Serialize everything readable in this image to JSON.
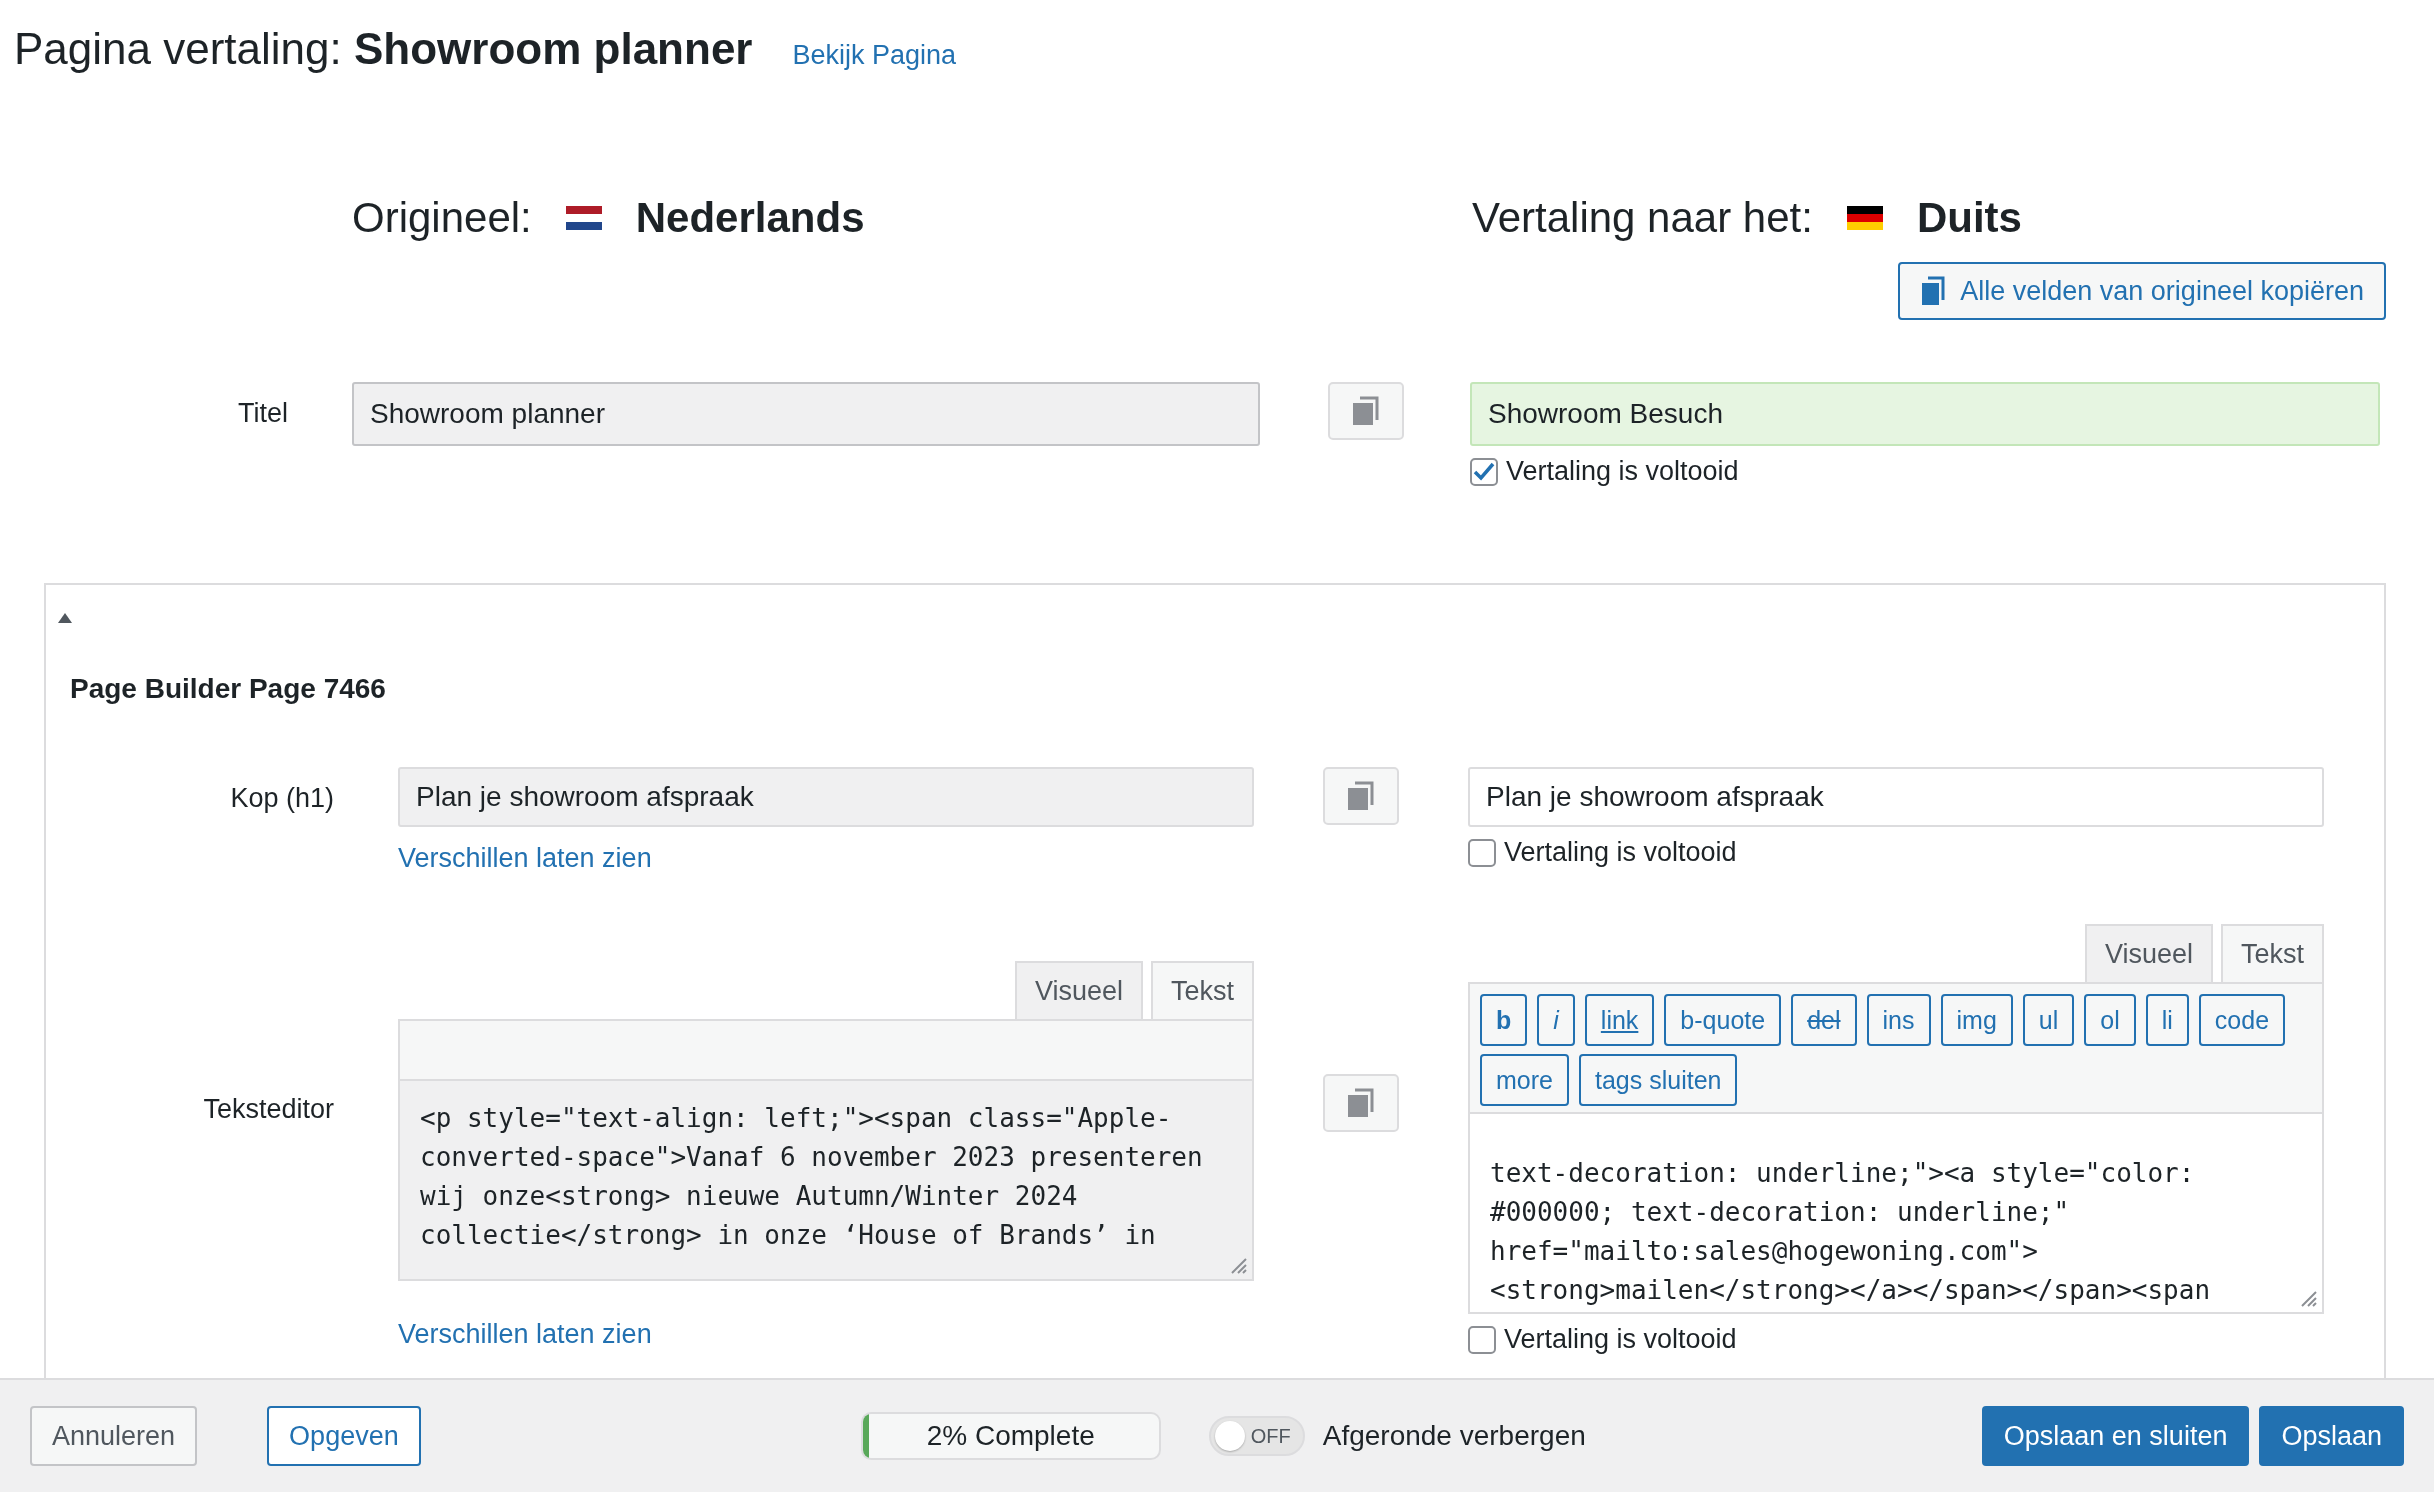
{
  "page": {
    "title_prefix": "Pagina vertaling:",
    "title": "Showroom planner",
    "view_link": "Bekijk Pagina"
  },
  "original": {
    "label": "Origineel:",
    "language": "Nederlands"
  },
  "translation": {
    "label": "Vertaling naar het:",
    "language": "Duits"
  },
  "copy_all_button": "Alle velden van origineel kopiëren",
  "title_field": {
    "label": "Titel",
    "original": "Showroom planner",
    "translation": "Showroom Besuch",
    "completed": true,
    "completed_label": "Vertaling is voltooid"
  },
  "section": {
    "expanded": true,
    "title": "Page Builder Page 7466",
    "fields": [
      {
        "kind": "text",
        "label": "Kop (h1)",
        "original": "Plan je showroom afspraak",
        "translation": "Plan je showroom afspraak",
        "diff_link": "Verschillen laten zien",
        "completed": false,
        "completed_label": "Vertaling is voltooid"
      },
      {
        "kind": "editor",
        "label": "Teksteditor",
        "original_tabs": [
          {
            "label": "Visueel",
            "selected": false
          },
          {
            "label": "Tekst",
            "selected": true
          }
        ],
        "translation_tabs": [
          {
            "label": "Visueel",
            "selected": false
          },
          {
            "label": "Tekst",
            "selected": true
          }
        ],
        "original_lines": [
          "<p style=\"text-align: left;\"><span class=\"Apple-",
          "converted-space\">Vanaf 6 november 2023 presenteren",
          "wij onze<strong> nieuwe Autumn/Winter 2024",
          "collectie</strong> in onze ‘House of Brands’ in"
        ],
        "toolbar": [
          {
            "label": "b",
            "kind": "bold"
          },
          {
            "label": "i",
            "kind": "italic"
          },
          {
            "label": "link",
            "kind": "underline"
          },
          {
            "label": "b-quote",
            "kind": "plain"
          },
          {
            "label": "del",
            "kind": "strike"
          },
          {
            "label": "ins",
            "kind": "plain"
          },
          {
            "label": "img",
            "kind": "plain"
          },
          {
            "label": "ul",
            "kind": "plain"
          },
          {
            "label": "ol",
            "kind": "plain"
          },
          {
            "label": "li",
            "kind": "plain"
          },
          {
            "label": "code",
            "kind": "plain"
          },
          {
            "label": "more",
            "kind": "plain"
          },
          {
            "label": "tags sluiten",
            "kind": "plain"
          }
        ],
        "translation_lines": [
          "text-decoration: underline;\"><a style=\"color:",
          "#000000; text-decoration: underline;\"",
          "href=\"mailto:sales@hogewoning.com\">",
          "<strong>mailen</strong></a></span></span><span"
        ],
        "diff_link": "Verschillen laten zien",
        "completed": false,
        "completed_label": "Vertaling is voltooid"
      }
    ]
  },
  "footer": {
    "cancel": "Annuleren",
    "submit": "Opgeven",
    "progress": {
      "label": "2% Complete",
      "level": 0.02
    },
    "hide_toggle": {
      "on": false,
      "state_label": "OFF",
      "label": "Afgeronde verbergen"
    },
    "save_close": "Opslaan en sluiten",
    "save": "Opslaan"
  }
}
